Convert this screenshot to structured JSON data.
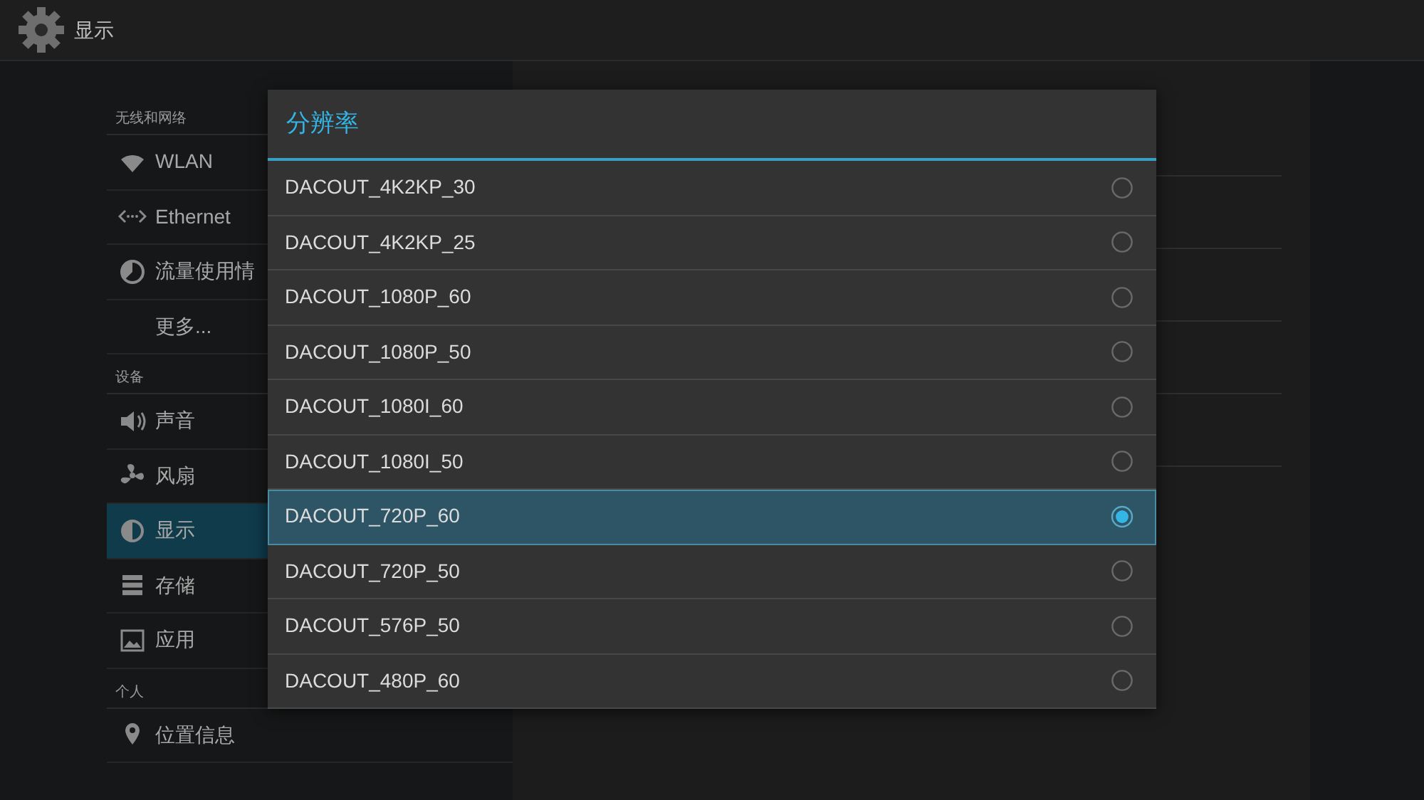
{
  "action_bar": {
    "title": "显示"
  },
  "sidebar": {
    "sections": [
      {
        "header": "无线和网络",
        "items": [
          {
            "label": "WLAN",
            "selected": false
          },
          {
            "label": "Ethernet",
            "selected": false
          },
          {
            "label": "流量使用情",
            "selected": false
          },
          {
            "label": "更多...",
            "selected": false
          }
        ]
      },
      {
        "header": "设备",
        "items": [
          {
            "label": "声音",
            "selected": false
          },
          {
            "label": "风扇",
            "selected": false
          },
          {
            "label": "显示",
            "selected": true
          },
          {
            "label": "存储",
            "selected": false
          },
          {
            "label": "应用",
            "selected": false
          }
        ]
      },
      {
        "header": "个人",
        "items": [
          {
            "label": "位置信息",
            "selected": false
          }
        ]
      }
    ]
  },
  "dialog": {
    "title": "分辨率",
    "options": [
      {
        "label": "DACOUT_4K2KP_30",
        "selected": false
      },
      {
        "label": "DACOUT_4K2KP_25",
        "selected": false
      },
      {
        "label": "DACOUT_1080P_60",
        "selected": false
      },
      {
        "label": "DACOUT_1080P_50",
        "selected": false
      },
      {
        "label": "DACOUT_1080I_60",
        "selected": false
      },
      {
        "label": "DACOUT_1080I_50",
        "selected": false
      },
      {
        "label": "DACOUT_720P_60",
        "selected": true
      },
      {
        "label": "DACOUT_720P_50",
        "selected": false
      },
      {
        "label": "DACOUT_576P_50",
        "selected": false
      },
      {
        "label": "DACOUT_480P_60",
        "selected": false
      }
    ]
  }
}
